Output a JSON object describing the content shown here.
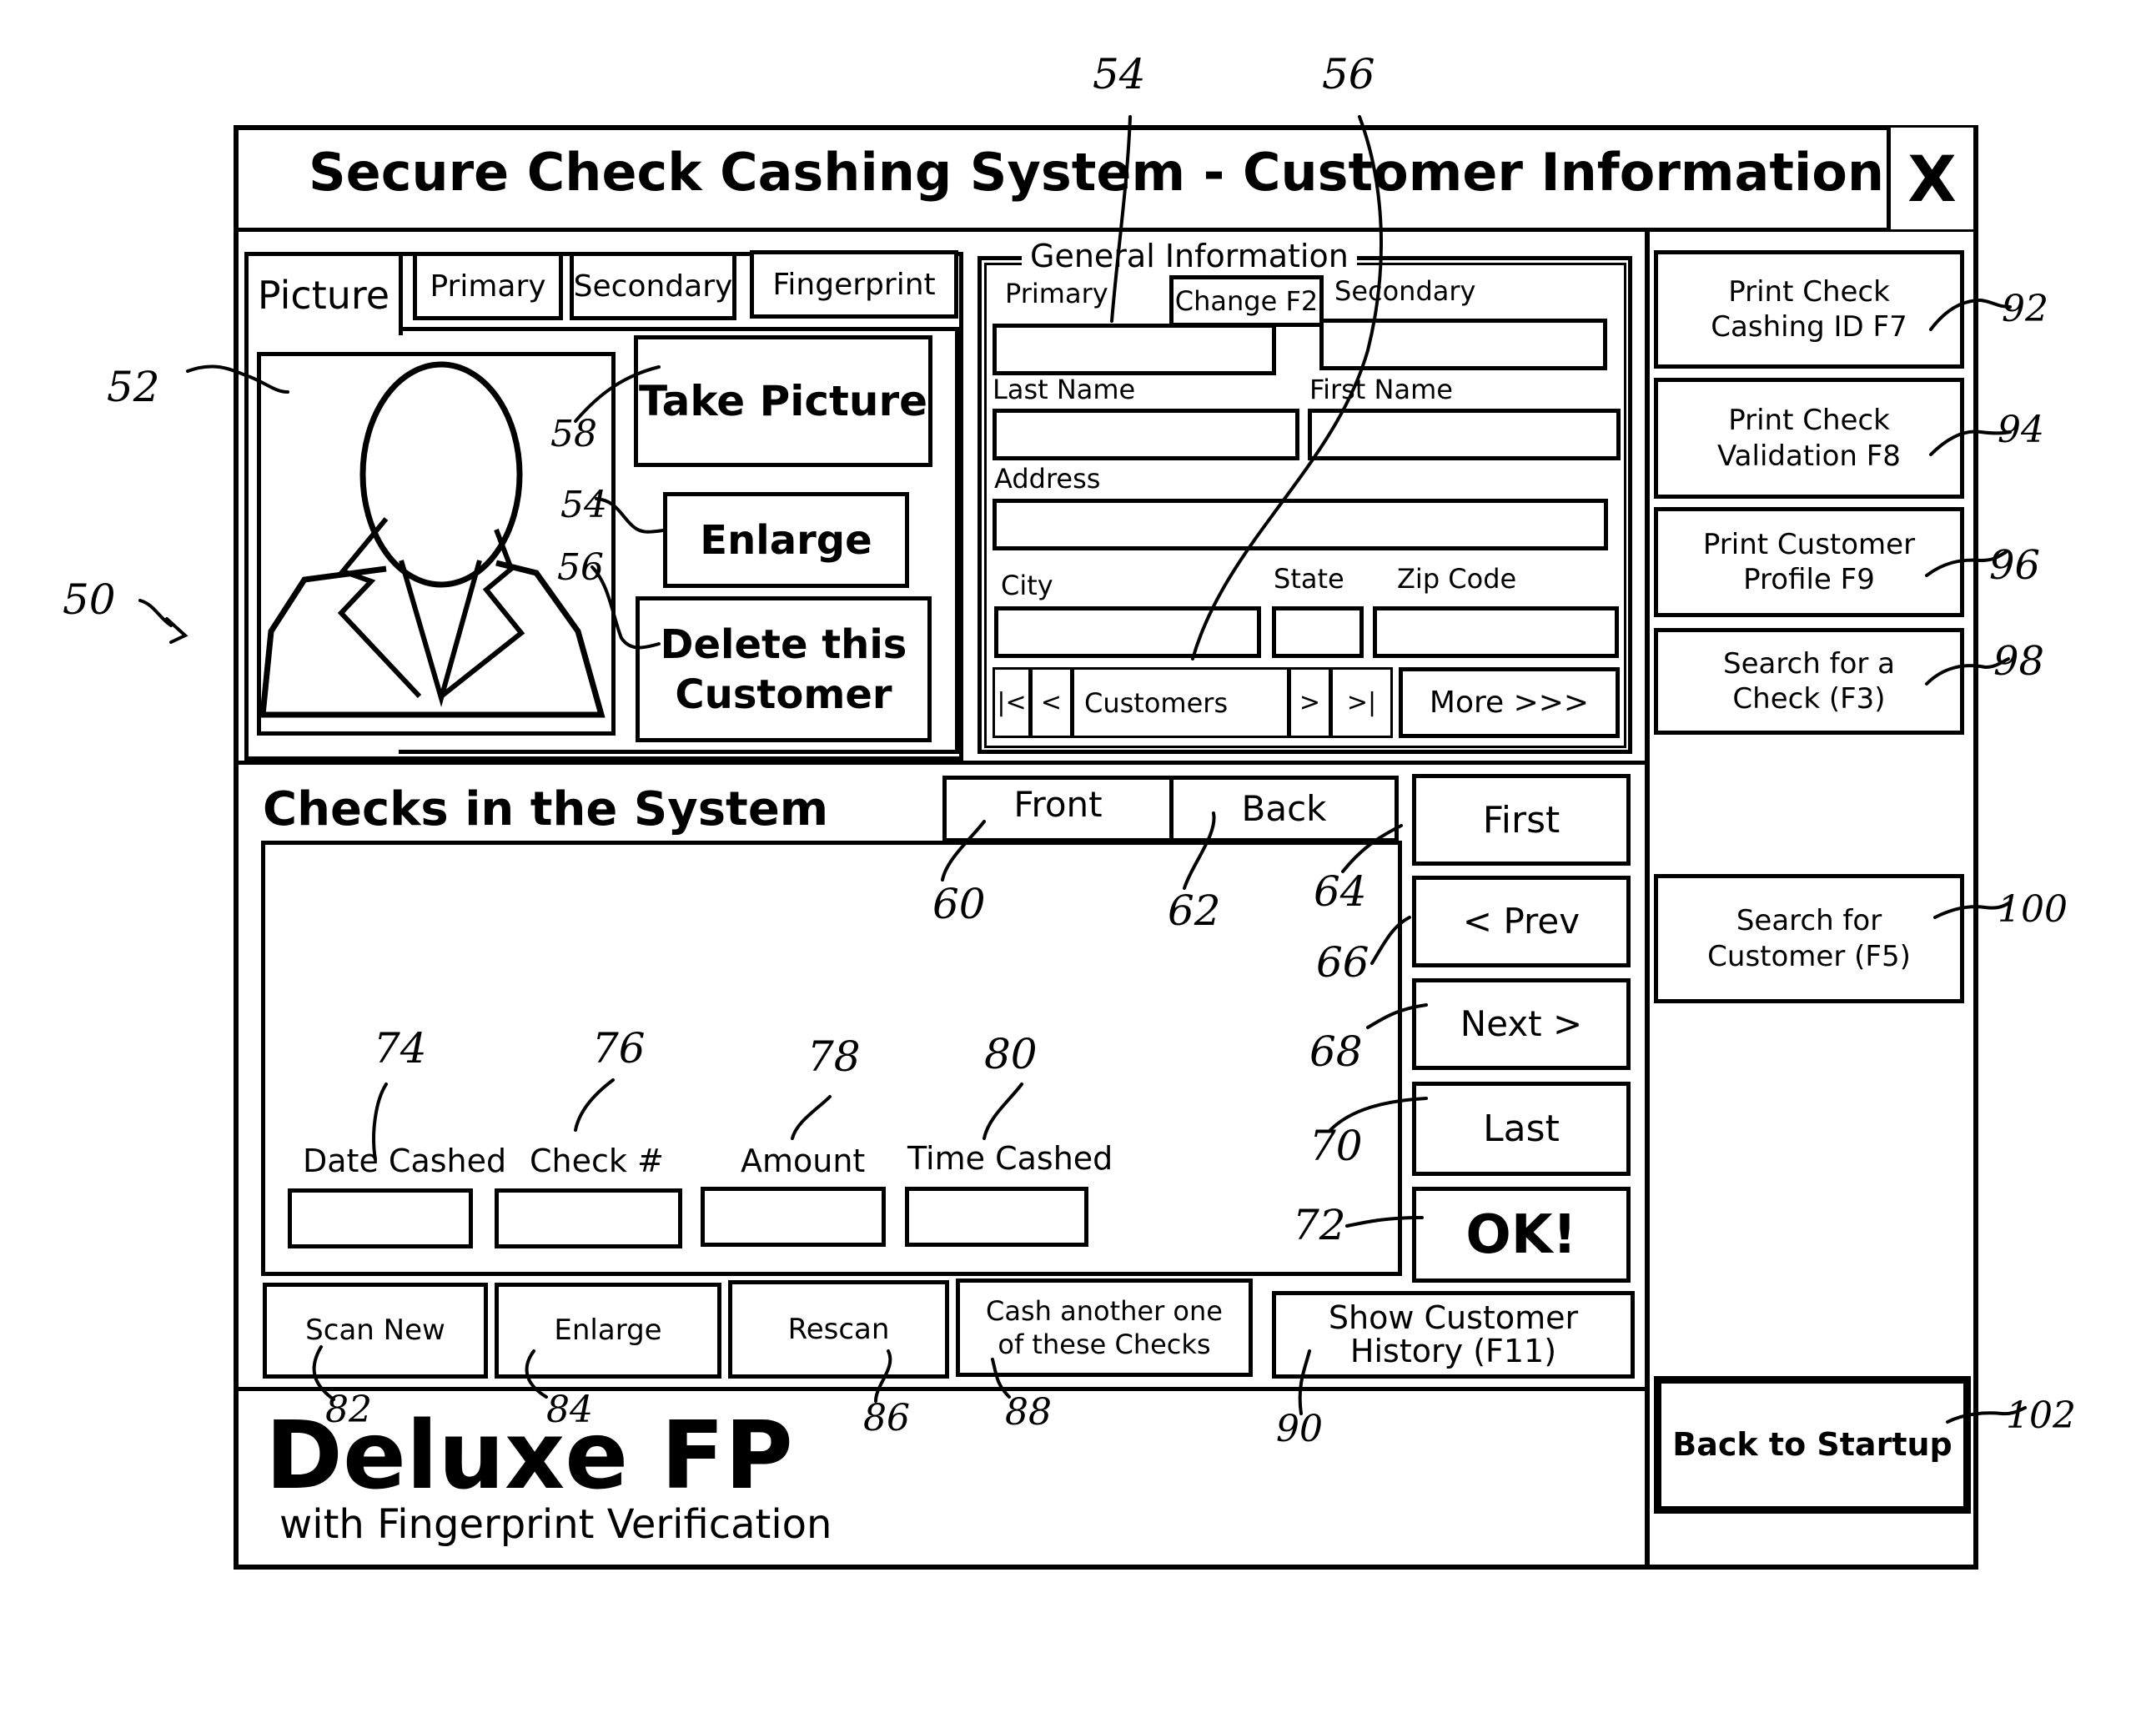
{
  "window": {
    "title": "Secure Check Cashing System - Customer Information",
    "close_label": "X"
  },
  "picture_panel": {
    "tabs": [
      {
        "label": "Picture",
        "active": true
      },
      {
        "label": "Primary",
        "active": false
      },
      {
        "label": "Secondary",
        "active": false
      },
      {
        "label": "Fingerprint",
        "active": false
      }
    ],
    "take_picture_label": "Take Picture",
    "enlarge_label": "Enlarge",
    "delete_customer_label": "Delete this\nCustomer",
    "avatar_icon": "person-silhouette-icon"
  },
  "general_info": {
    "group_label": "General Information",
    "primary_label": "Primary",
    "change_button_label": "Change F2",
    "secondary_label": "Secondary",
    "primary_id_value": "",
    "secondary_id_value": "",
    "last_name_label": "Last Name",
    "last_name_value": "",
    "first_name_label": "First Name",
    "first_name_value": "",
    "address_label": "Address",
    "address_value": "",
    "city_label": "City",
    "city_value": "",
    "state_label": "State",
    "state_value": "",
    "zip_label": "Zip Code",
    "zip_value": "",
    "nav": {
      "first_label": "|<",
      "prev_label": "<",
      "record_label": "Customers",
      "next_label": ">",
      "last_label": ">|"
    },
    "more_label": "More >>>"
  },
  "checks": {
    "heading": "Checks in the System",
    "front_label": "Front",
    "back_label": "Back",
    "nav": {
      "first_label": "First",
      "prev_label": "< Prev",
      "next_label": "Next >",
      "last_label": "Last"
    },
    "ok_label": "OK!",
    "fields": [
      {
        "label": "Date Cashed",
        "value": ""
      },
      {
        "label": "Check #",
        "value": ""
      },
      {
        "label": "Amount",
        "value": ""
      },
      {
        "label": "Time Cashed",
        "value": ""
      }
    ],
    "actions": [
      {
        "label": "Scan New"
      },
      {
        "label": "Enlarge"
      },
      {
        "label": "Rescan"
      },
      {
        "label": "Cash another one\nof these Checks"
      },
      {
        "label": "Show Customer\nHistory  (F11)"
      }
    ]
  },
  "branding": {
    "product_name": "Deluxe FP",
    "tagline": "with Fingerprint Verification"
  },
  "sidebar": {
    "buttons": [
      {
        "label": "Print Check\nCashing ID   F7"
      },
      {
        "label": "Print Check\nValidation F8"
      },
      {
        "label": "Print Customer\nProfile  F9"
      },
      {
        "label": "Search for a\nCheck (F3)"
      },
      {
        "label": "Search for\nCustomer (F5)"
      },
      {
        "label": "Back to Startup"
      }
    ]
  },
  "reference_numerals": {
    "figure": "50",
    "picture": "52",
    "enlarge": "54",
    "delete": "56",
    "take_picture": "58",
    "front": "60",
    "back": "62",
    "first": "64",
    "prev": "66",
    "next": "68",
    "last": "70",
    "ok": "72",
    "date_cashed": "74",
    "check_no": "76",
    "amount": "78",
    "time_cashed": "80",
    "scan_new": "82",
    "enlarge_check": "84",
    "rescan": "86",
    "cash_another": "88",
    "history": "90",
    "print_id": "92",
    "print_validation": "94",
    "print_profile": "96",
    "search_check": "98",
    "search_customer": "100",
    "back_to_startup": "102",
    "top_54": "54",
    "top_56": "56"
  }
}
